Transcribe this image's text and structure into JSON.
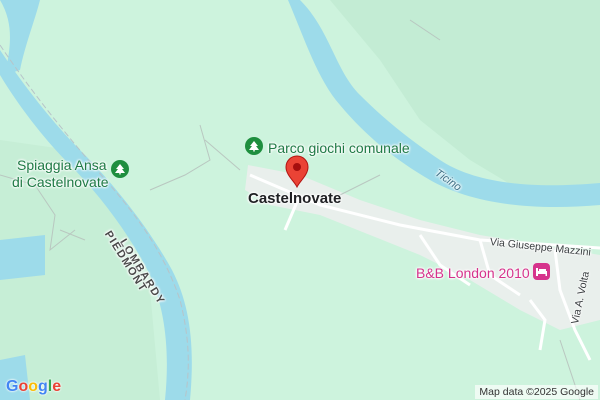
{
  "map": {
    "labels": {
      "park": "Parco giochi comunale",
      "beach_line1": "Spiaggia Ansa",
      "beach_line2": "di Castelnovate",
      "town": "Castelnovate",
      "street_mazzini": "Via Giuseppe Mazzini",
      "street_volta": "Via A. Volta",
      "hotel": "B&B London 2010",
      "region_lombardy": "LOMBARDY",
      "region_piedmont": "PIEDMONT",
      "river": "Ticino"
    },
    "attribution": "Map data ©2025 Google",
    "logo": "Google",
    "colors": {
      "land": "#cdf3dd",
      "park_land": "#bfe9cf",
      "water": "#9ddbea",
      "pin": "#ea4335",
      "poi_green": "#1e8e3e",
      "poi_pink": "#d6338c"
    }
  }
}
